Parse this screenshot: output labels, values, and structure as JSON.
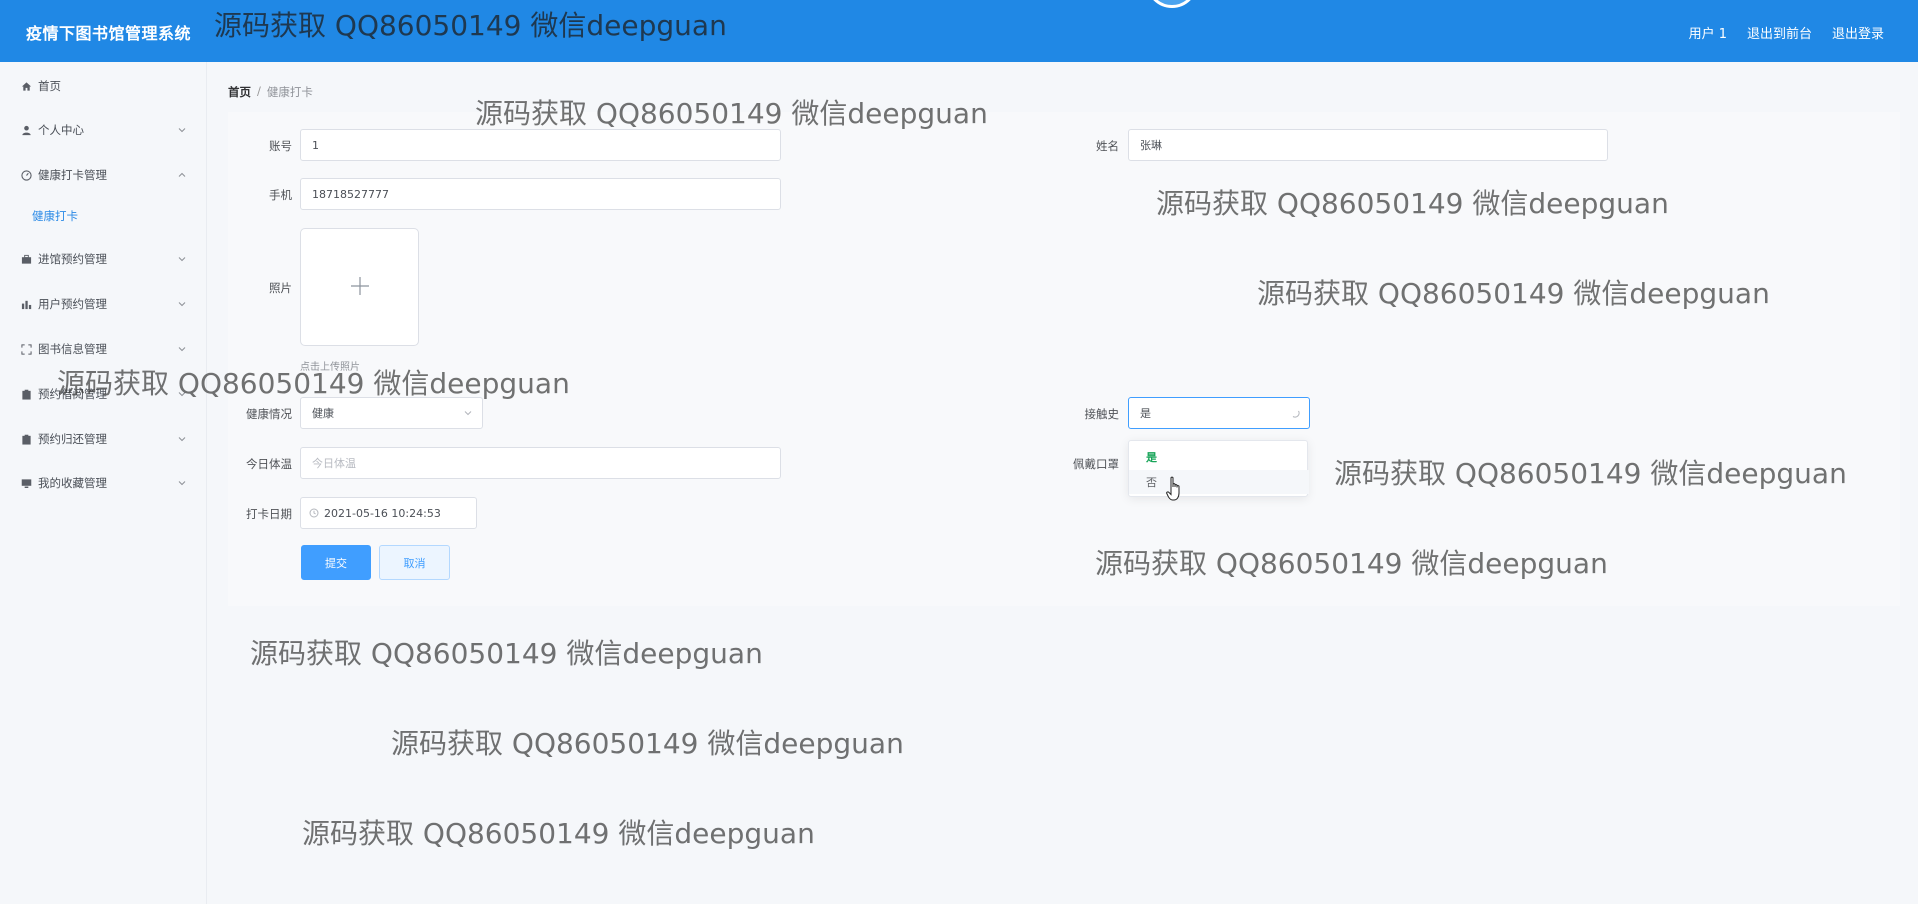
{
  "header": {
    "title": "疫情下图书馆管理系统",
    "user_label": "用户 1",
    "front_label": "退出到前台",
    "logout_label": "退出登录"
  },
  "sidebar": {
    "items": [
      {
        "label": "首页",
        "icon": "home-icon"
      },
      {
        "label": "个人中心",
        "icon": "user-icon"
      },
      {
        "label": "健康打卡管理",
        "icon": "gauge-icon"
      },
      {
        "label": "进馆预约管理",
        "icon": "briefcase-icon"
      },
      {
        "label": "用户预约管理",
        "icon": "bar-chart-icon"
      },
      {
        "label": "图书信息管理",
        "icon": "fullscreen-icon"
      },
      {
        "label": "预约借阅管理",
        "icon": "clipboard-icon"
      },
      {
        "label": "预约归还管理",
        "icon": "clipboard-icon"
      },
      {
        "label": "我的收藏管理",
        "icon": "monitor-icon"
      }
    ],
    "sub_items": [
      {
        "label": "健康打卡"
      }
    ]
  },
  "breadcrumb": {
    "home": "首页",
    "separator": "/",
    "current": "健康打卡"
  },
  "form": {
    "account": {
      "label": "账号",
      "value": "1"
    },
    "name": {
      "label": "姓名",
      "value": "张琳"
    },
    "phone": {
      "label": "手机",
      "value": "18718527777"
    },
    "photo": {
      "label": "照片",
      "tip": "点击上传照片"
    },
    "health": {
      "label": "健康情况",
      "value": "健康"
    },
    "contact": {
      "label": "接触史",
      "value": "是"
    },
    "temperature": {
      "label": "今日体温",
      "placeholder": "今日体温"
    },
    "mask": {
      "label": "佩戴口罩"
    },
    "date": {
      "label": "打卡日期",
      "value": "2021-05-16 10:24:53"
    },
    "submit_label": "提交",
    "cancel_label": "取消"
  },
  "dropdown": {
    "options": [
      "是",
      "否"
    ],
    "selected": "是"
  },
  "watermark": "源码获取 QQ86050149 微信deepguan",
  "colors": {
    "header_bg": "#2088e5",
    "primary": "#409eff",
    "active_submenu": "#2b8ae6",
    "selected_option": "#19a55a"
  }
}
